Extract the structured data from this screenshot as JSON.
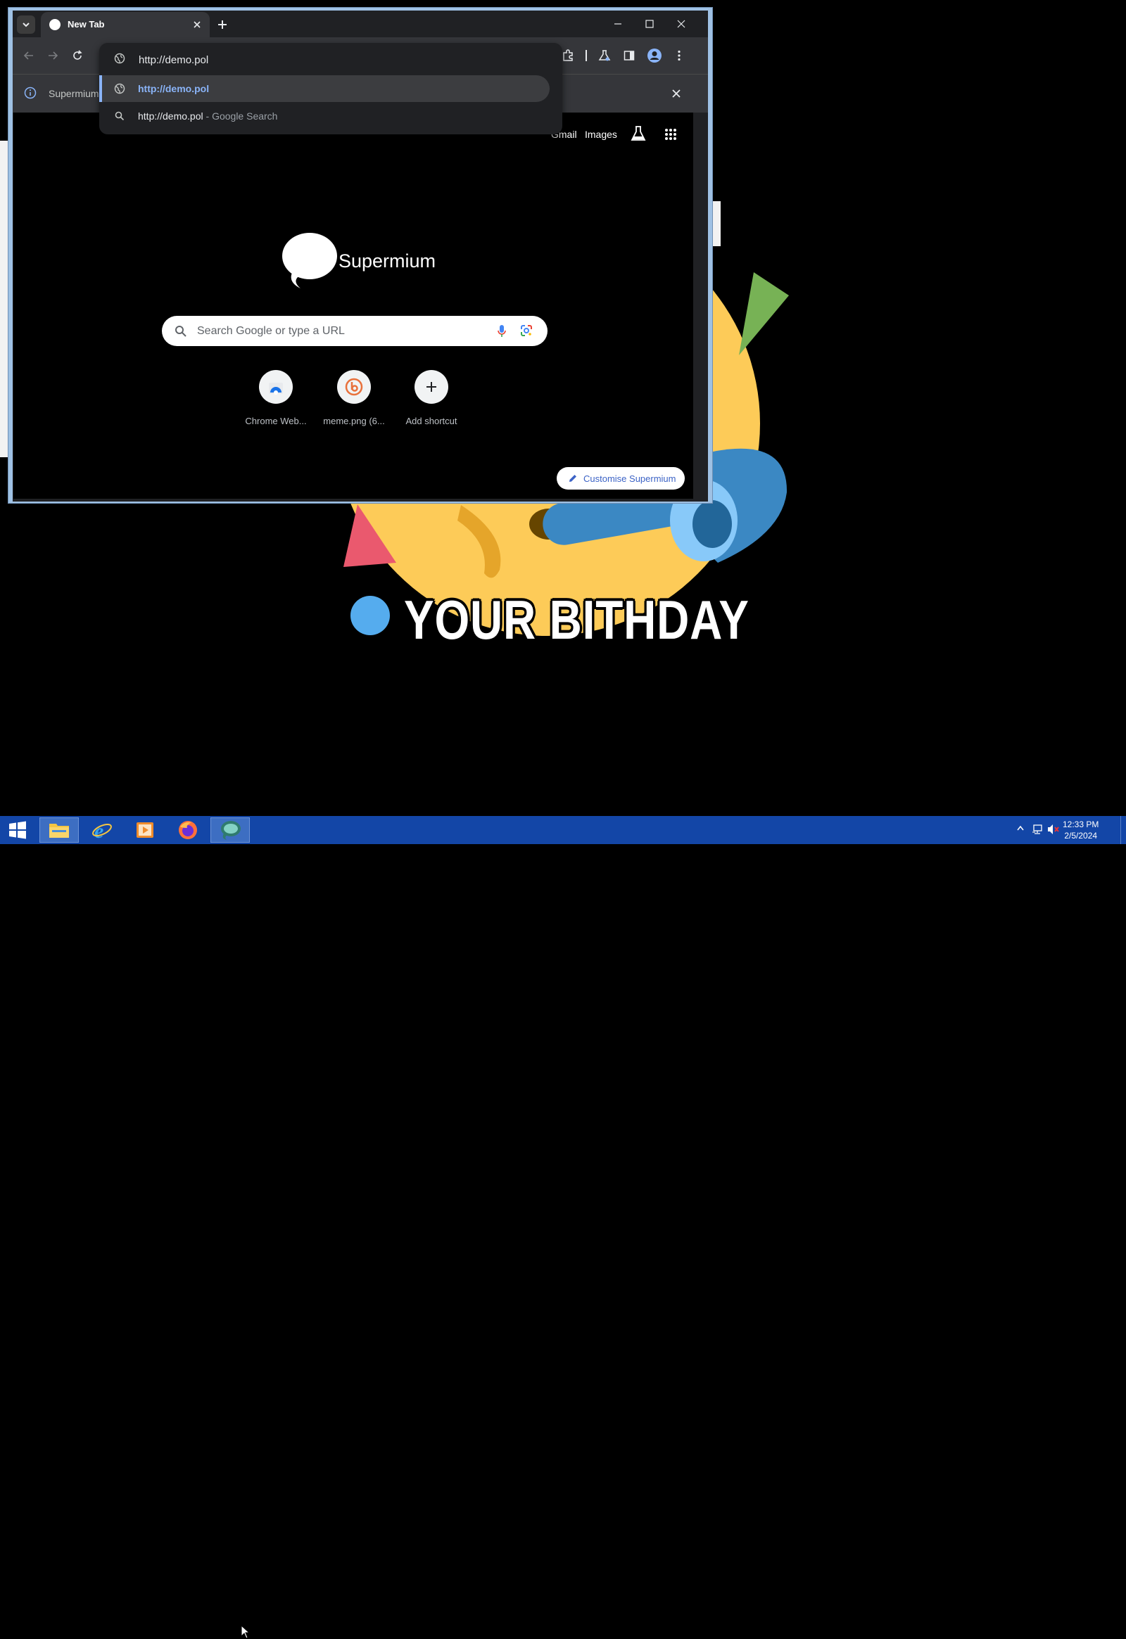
{
  "browser": {
    "tab_title": "New Tab",
    "omnibox": {
      "value": "http://demo.pol",
      "suggestions": [
        {
          "text": "http://demo.pol",
          "suffix": ""
        },
        {
          "text": "http://demo.pol",
          "suffix": "- Google Search"
        }
      ]
    },
    "infobar_text": "Supermium"
  },
  "ntp": {
    "links": {
      "gmail": "Gmail",
      "images": "Images"
    },
    "logo_text": "Supermium",
    "search_placeholder": "Search Google or type a URL",
    "shortcuts": [
      {
        "label": "Chrome Web..."
      },
      {
        "label": "meme.png (6..."
      },
      {
        "label": "Add shortcut"
      }
    ],
    "customise_label": "Customise Supermium"
  },
  "wallpaper": {
    "meme_text": "YOUR BITHDAY"
  },
  "taskbar": {
    "time": "12:33 PM",
    "date": "2/5/2024"
  },
  "colors": {
    "accent_blue": "#8ab4f8",
    "taskbar": "#1346a7",
    "emoji_yellow": "#fdcb58"
  }
}
